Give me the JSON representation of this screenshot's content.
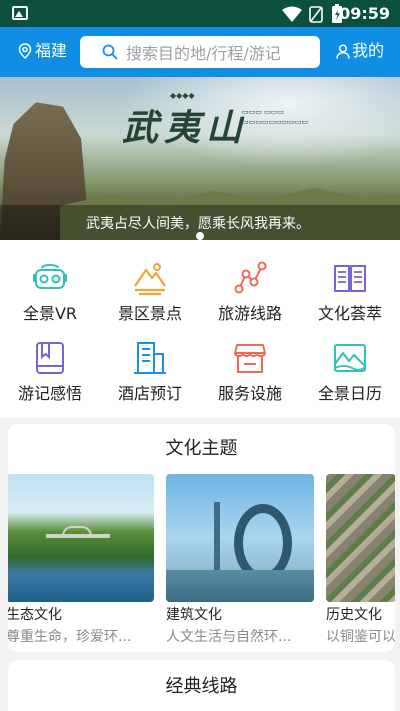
{
  "status_bar": {
    "time": "09:59"
  },
  "header": {
    "location": "福建",
    "search_placeholder": "搜索目的地/行程/游记",
    "mine": "我的"
  },
  "banner": {
    "logo_text": "武夷山",
    "caption": "武夷占尽人间美，愿乘长风我再来。",
    "slides": 1,
    "active_slide": 1
  },
  "menu": [
    {
      "label": "全景VR",
      "icon": "vr-goggles-icon",
      "color": "#33c0b6"
    },
    {
      "label": "景区景点",
      "icon": "mountain-icon",
      "color": "#f2a33a"
    },
    {
      "label": "旅游线路",
      "icon": "route-icon",
      "color": "#f06a5a"
    },
    {
      "label": "文化荟萃",
      "icon": "book-icon",
      "color": "#7a62d6"
    },
    {
      "label": "游记感悟",
      "icon": "journal-icon",
      "color": "#7a62d6"
    },
    {
      "label": "酒店预订",
      "icon": "hotel-icon",
      "color": "#1e8fe0"
    },
    {
      "label": "服务设施",
      "icon": "shop-icon",
      "color": "#f06a5a"
    },
    {
      "label": "全景日历",
      "icon": "landscape-calendar-icon",
      "color": "#33c0b6"
    }
  ],
  "culture": {
    "title": "文化主题",
    "items": [
      {
        "name": "生态文化",
        "sub": "尊重生命，珍爱环..."
      },
      {
        "name": "建筑文化",
        "sub": "人文生活与自然环..."
      },
      {
        "name": "历史文化",
        "sub": "以铜鉴可以"
      }
    ]
  },
  "routes": {
    "title": "经典线路"
  }
}
